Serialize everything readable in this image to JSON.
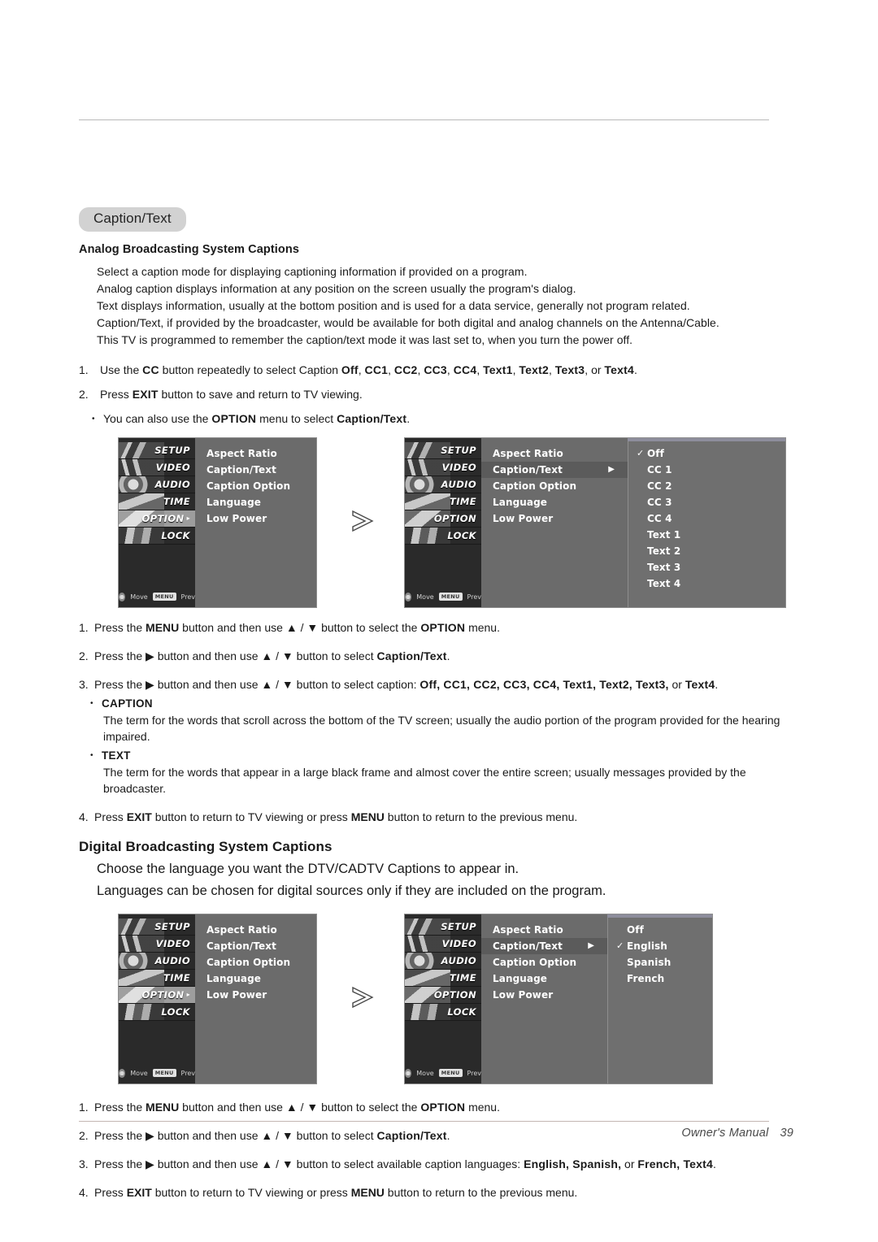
{
  "section": {
    "pill_label": "Caption/Text"
  },
  "analog": {
    "heading": "Analog Broadcasting System Captions",
    "paragraphs": [
      "Select a caption mode for displaying captioning information if provided on a program.",
      "Analog caption displays information at any position on the screen usually the program's dialog.",
      "Text displays information, usually at the bottom position and is used for a data service, generally not program related.",
      "Caption/Text, if provided by the broadcaster, would be available for both digital and analog channels on the  Antenna/Cable.",
      "This TV is programmed to remember the caption/text mode it was last set to, when you turn the power off."
    ],
    "steps": [
      {
        "num": "1.",
        "parts": [
          "Use the ",
          "CC",
          " button repeatedly to select Caption ",
          "Off",
          ", ",
          "CC1",
          ", ",
          "CC2",
          ", ",
          "CC3",
          ", ",
          "CC4",
          ", ",
          "Text1",
          ", ",
          "Text2",
          ", ",
          "Text3",
          ", or ",
          "Text4",
          "."
        ]
      },
      {
        "num": "2.",
        "parts": [
          "Press ",
          "EXIT",
          " button to save and return to TV viewing."
        ]
      }
    ],
    "bullet": {
      "dot": "•",
      "pre": "You can also use the ",
      "bold1": "OPTION",
      "mid": " menu to select ",
      "bold2": "Caption/Text",
      "post": "."
    },
    "instructions": [
      {
        "num": "1.",
        "text_a": "Press the ",
        "bold_a": "MENU",
        "text_b": " button and then use ",
        "arrows": "▲ / ▼",
        "text_c": " button to select the ",
        "bold_b": "OPTION",
        "text_d": " menu."
      },
      {
        "num": "2.",
        "text_a": "Press the ",
        "bold_a": "▶",
        "text_b": " button and then use ",
        "arrows": "▲ / ▼",
        "text_c": " button to select ",
        "bold_b": "Caption/Text",
        "text_d": "."
      },
      {
        "num": "3.",
        "text_a": "Press the ",
        "bold_a": "▶",
        "text_b": " button and then use ",
        "arrows": "▲ / ▼",
        "text_c": " button to select caption: ",
        "bold_b": "Off,  CC1, CC2, CC3, CC4, Text1, Text2, Text3,",
        "text_d": " or ",
        "bold_c": "Text4",
        "text_e": "."
      },
      {
        "num": "4.",
        "text_a": "Press ",
        "bold_a": "EXIT",
        "text_b": " button to return to TV viewing or press ",
        "bold_b": "MENU",
        "text_c": " button to return to the previous menu."
      }
    ],
    "definitions": [
      {
        "dot": "•",
        "term": "CAPTION",
        "body": "The term for the words that scroll across the bottom of the TV screen; usually the audio portion of the program provided for the hearing impaired."
      },
      {
        "dot": "•",
        "term": "TEXT",
        "body": "The term for the words that appear in a large black frame and almost cover the entire screen; usually messages provided by the broadcaster."
      }
    ]
  },
  "digital": {
    "heading": "Digital Broadcasting System Captions",
    "paragraphs": [
      "Choose the language you want the DTV/CADTV Captions to appear in.",
      "Languages can be chosen for digital sources only if they are included on the program."
    ],
    "instructions": [
      {
        "num": "1.",
        "text_a": "Press the ",
        "bold_a": "MENU",
        "text_b": " button and then use ",
        "arrows": "▲ / ▼",
        "text_c": " button to select the ",
        "bold_b": "OPTION",
        "text_d": " menu."
      },
      {
        "num": "2.",
        "text_a": "Press the ",
        "bold_a": "▶",
        "text_b": " button and then use ",
        "arrows": "▲ / ▼",
        "text_c": " button to select ",
        "bold_b": "Caption/Text",
        "text_d": "."
      },
      {
        "num": "3.",
        "text_a": "Press the ",
        "bold_a": "▶",
        "text_b": " button and then use ",
        "arrows": "▲ / ▼",
        "text_c": " button to select available caption languages: ",
        "bold_b": "English,  Spanish,",
        "text_d": " or ",
        "bold_c": "French, Text4",
        "text_e": "."
      },
      {
        "num": "4.",
        "text_a": "Press ",
        "bold_a": "EXIT",
        "text_b": " button to return to TV viewing or press ",
        "bold_b": "MENU",
        "text_c": " button to return to the previous menu."
      }
    ]
  },
  "osd": {
    "sidebar": [
      {
        "label": "SETUP",
        "selected": false
      },
      {
        "label": "VIDEO",
        "selected": false
      },
      {
        "label": "AUDIO",
        "selected": false
      },
      {
        "label": "TIME",
        "selected": false
      },
      {
        "label": "OPTION",
        "selected": true
      },
      {
        "label": "LOCK",
        "selected": false
      }
    ],
    "menu_items": [
      "Aspect Ratio",
      "Caption/Text",
      "Caption Option",
      "Language",
      "Low Power"
    ],
    "statusbar": {
      "move_label": "Move",
      "menu_key": "MENU",
      "prev_label": "Prev"
    },
    "caption_text_submenu": [
      "Off",
      "CC 1",
      "CC 2",
      "CC 3",
      "CC 4",
      "Text 1",
      "Text 2",
      "Text 3",
      "Text 4"
    ],
    "caption_text_checked": "Off",
    "language_submenu": [
      "Off",
      "English",
      "Spanish",
      "French"
    ],
    "language_checked": "English",
    "check_glyph": "✓",
    "arrow_glyph": "▶",
    "highlighted_item": "Caption/Text"
  },
  "footer": {
    "manual_label": "Owner's Manual",
    "page_number": "39"
  },
  "colors": {
    "pill_bg": "#d2d2d2",
    "osd_panel": "#6b6b6b",
    "osd_sidebar": "#2a2a2a",
    "osd_highlight": "#9d9d9d"
  }
}
